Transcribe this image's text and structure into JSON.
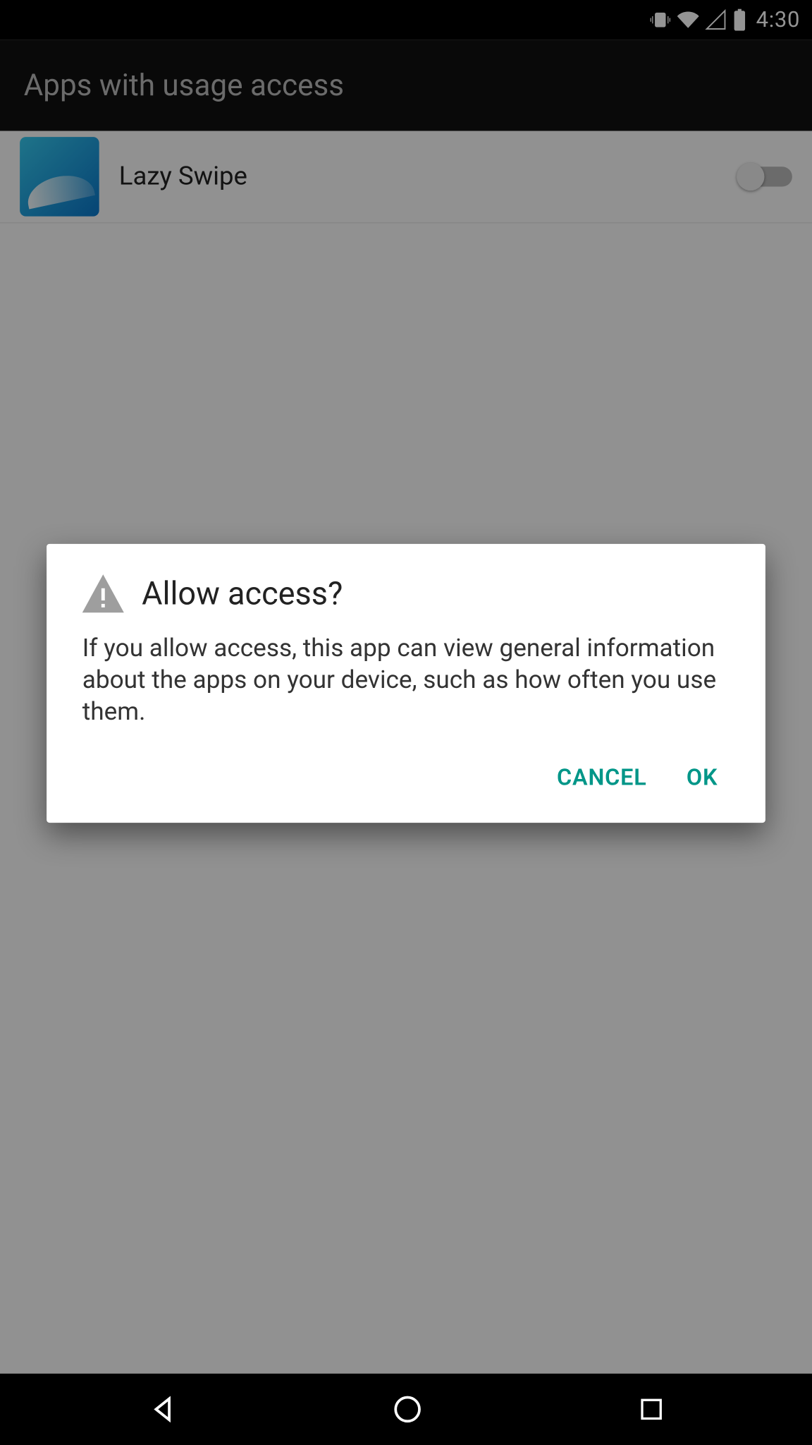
{
  "status": {
    "time": "4:30"
  },
  "header": {
    "title": "Apps with usage access"
  },
  "apps": [
    {
      "name": "Lazy Swipe",
      "enabled": false
    }
  ],
  "dialog": {
    "title": "Allow access?",
    "body": "If you allow access, this app can view general information about the apps on your device, such as how often you use them.",
    "cancel": "CANCEL",
    "ok": "OK"
  }
}
